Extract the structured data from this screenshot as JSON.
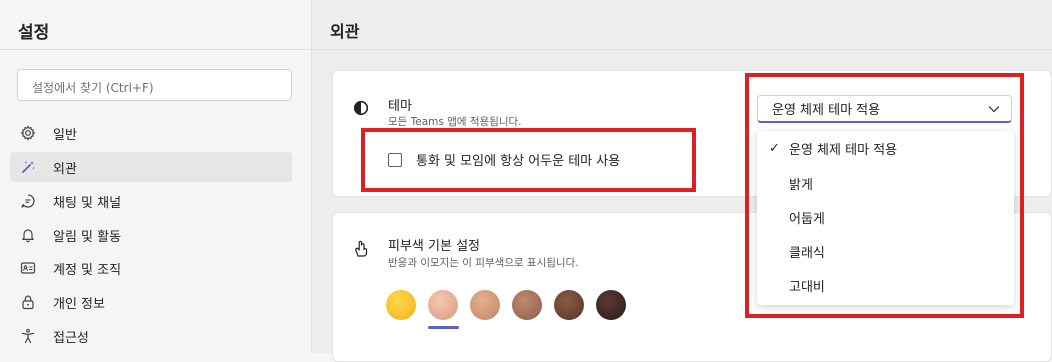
{
  "sidebar": {
    "title": "설정",
    "search_placeholder": "설정에서 찾기 (Ctrl+F)",
    "items": [
      {
        "label": "일반",
        "icon": "gear-icon"
      },
      {
        "label": "외관",
        "icon": "magic-wand-icon",
        "selected": true
      },
      {
        "label": "채팅 및 채널",
        "icon": "chat-icon"
      },
      {
        "label": "알림 및 활동",
        "icon": "bell-icon"
      },
      {
        "label": "계정 및 조직",
        "icon": "id-card-icon"
      },
      {
        "label": "개인 정보",
        "icon": "lock-icon"
      },
      {
        "label": "접근성",
        "icon": "accessibility-icon"
      }
    ]
  },
  "main": {
    "title": "외관",
    "theme": {
      "title": "테마",
      "subtitle": "모든 Teams 앱에 적용됩니다.",
      "checkbox_label": "통화 및 모임에 항상 어두운 테마 사용",
      "checkbox_checked": false,
      "selected": "운영 체제 테마 적용",
      "options": [
        "운영 체제 테마 적용",
        "밝게",
        "어둡게",
        "클래식",
        "고대비"
      ]
    },
    "skin_tone": {
      "title": "피부색 기본 설정",
      "subtitle": "반응과 이모지는 이 피부색으로 표시됩니다.",
      "colors": [
        "#f7c22a",
        "#e9b196",
        "#d29c7a",
        "#a8735c",
        "#6e4334",
        "#3a2623"
      ],
      "selected_index": 1
    }
  },
  "colors": {
    "accent": "#5b5fc7",
    "highlight": "#e02020"
  }
}
